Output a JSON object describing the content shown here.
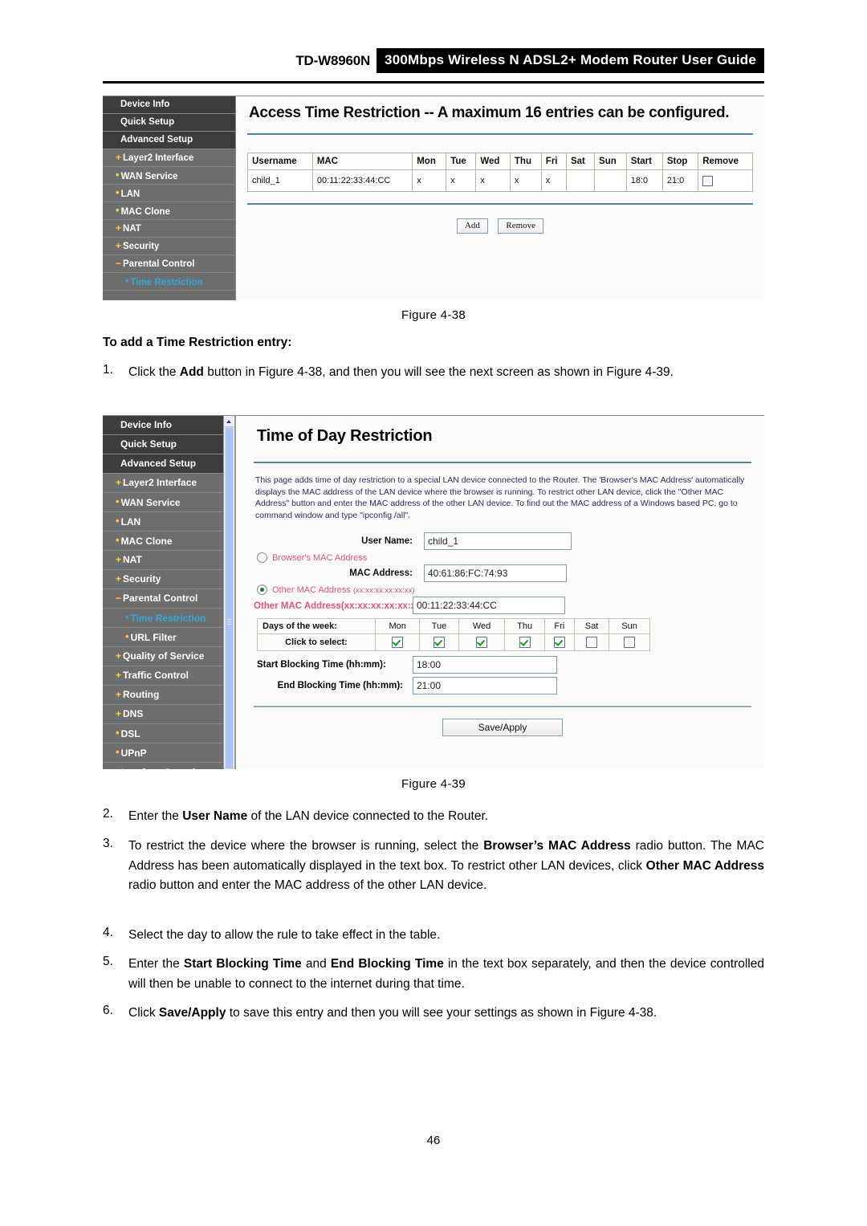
{
  "header": {
    "model": "TD-W8960N",
    "title": "300Mbps Wireless N ADSL2+ Modem Router User Guide"
  },
  "figure_4_38": {
    "panel_title": "Access Time Restriction -- A maximum 16 entries can be configured.",
    "sidebar": [
      {
        "label": "Device Info",
        "level": "top",
        "bullet": "",
        "active": false
      },
      {
        "label": "Quick Setup",
        "level": "top",
        "bullet": "",
        "active": false
      },
      {
        "label": "Advanced Setup",
        "level": "top",
        "bullet": "",
        "active": false
      },
      {
        "label": "Layer2 Interface",
        "level": "sub",
        "bullet": "+",
        "active": false
      },
      {
        "label": "WAN Service",
        "level": "sub",
        "bullet": "•",
        "active": false
      },
      {
        "label": "LAN",
        "level": "sub",
        "bullet": "•",
        "active": false
      },
      {
        "label": "MAC Clone",
        "level": "sub",
        "bullet": "•",
        "active": false
      },
      {
        "label": "NAT",
        "level": "sub",
        "bullet": "+",
        "active": false
      },
      {
        "label": "Security",
        "level": "sub",
        "bullet": "+",
        "active": false
      },
      {
        "label": "Parental Control",
        "level": "sub",
        "bullet": "−",
        "active": false
      },
      {
        "label": "Time Restriction",
        "level": "sub2",
        "bullet": "•",
        "active": true
      }
    ],
    "table": {
      "columns": [
        "Username",
        "MAC",
        "Mon",
        "Tue",
        "Wed",
        "Thu",
        "Fri",
        "Sat",
        "Sun",
        "Start",
        "Stop",
        "Remove"
      ],
      "rows": [
        {
          "username": "child_1",
          "mac": "00:11:22:33:44:CC",
          "mon": "x",
          "tue": "x",
          "wed": "x",
          "thu": "x",
          "fri": "x",
          "sat": "",
          "sun": "",
          "start": "18:0",
          "stop": "21:0",
          "remove_checked": false
        }
      ]
    },
    "buttons": {
      "add": "Add",
      "remove": "Remove"
    }
  },
  "caption_4_38": "Figure 4-38",
  "section_heading": "To add a Time Restriction entry:",
  "step1": {
    "num": "1.",
    "parts": [
      {
        "t": "Click the ",
        "b": false
      },
      {
        "t": "Add",
        "b": true
      },
      {
        "t": " button in Figure 4-38, and then you will see the next screen as shown in Figure 4-39.",
        "b": false
      }
    ]
  },
  "figure_4_39": {
    "panel_title": "Time of Day Restriction",
    "description": "This page adds time of day restriction to a special LAN device connected to the Router. The 'Browser's MAC Address' automatically displays the MAC address of the LAN device where the browser is running. To restrict other LAN device, click the \"Other MAC Address\" button and enter the MAC address of the other LAN device. To find out the MAC address of a Windows based PC, go to command window and type \"ipconfig /all\".",
    "sidebar": [
      {
        "label": "Device Info",
        "level": "top",
        "bullet": "",
        "active": false
      },
      {
        "label": "Quick Setup",
        "level": "top",
        "bullet": "",
        "active": false
      },
      {
        "label": "Advanced Setup",
        "level": "top",
        "bullet": "",
        "active": false
      },
      {
        "label": "Layer2 Interface",
        "level": "sub",
        "bullet": "+",
        "active": false
      },
      {
        "label": "WAN Service",
        "level": "sub",
        "bullet": "•",
        "active": false
      },
      {
        "label": "LAN",
        "level": "sub",
        "bullet": "•",
        "active": false
      },
      {
        "label": "MAC Clone",
        "level": "sub",
        "bullet": "•",
        "active": false
      },
      {
        "label": "NAT",
        "level": "sub",
        "bullet": "+",
        "active": false
      },
      {
        "label": "Security",
        "level": "sub",
        "bullet": "+",
        "active": false
      },
      {
        "label": "Parental Control",
        "level": "sub",
        "bullet": "−",
        "active": false
      },
      {
        "label": "Time Restriction",
        "level": "sub2",
        "bullet": "•",
        "active": true
      },
      {
        "label": "URL Filter",
        "level": "sub2",
        "bullet": "•",
        "active": false
      },
      {
        "label": "Quality of Service",
        "level": "sub",
        "bullet": "+",
        "active": false
      },
      {
        "label": "Traffic Control",
        "level": "sub",
        "bullet": "+",
        "active": false
      },
      {
        "label": "Routing",
        "level": "sub",
        "bullet": "+",
        "active": false
      },
      {
        "label": "DNS",
        "level": "sub",
        "bullet": "+",
        "active": false
      },
      {
        "label": "DSL",
        "level": "sub",
        "bullet": "•",
        "active": false
      },
      {
        "label": "UPnP",
        "level": "sub",
        "bullet": "•",
        "active": false
      },
      {
        "label": "Interface Grouping",
        "level": "sub",
        "bullet": "•",
        "active": false
      }
    ],
    "form": {
      "user_name_label": "User Name:",
      "user_name_value": "child_1",
      "browsers_mac_radio_label": "Browser's MAC Address",
      "browsers_mac_selected": false,
      "mac_address_label": "MAC Address:",
      "mac_address_value": "40:61:86:FC:74:93",
      "other_mac_radio_label": "Other MAC Address",
      "other_mac_radio_format": "(xx:xx:xx:xx:xx:xx)",
      "other_mac_selected": true,
      "other_mac_label": "Other MAC Address(xx:xx:xx:xx:xx:xx):",
      "other_mac_value": "00:11:22:33:44:CC",
      "days_label": "Days of the week:",
      "click_label": "Click to select:",
      "days": [
        {
          "name": "Mon",
          "checked": true
        },
        {
          "name": "Tue",
          "checked": true
        },
        {
          "name": "Wed",
          "checked": true
        },
        {
          "name": "Thu",
          "checked": true
        },
        {
          "name": "Fri",
          "checked": true
        },
        {
          "name": "Sat",
          "checked": false
        },
        {
          "name": "Sun",
          "checked": false
        }
      ],
      "start_label": "Start Blocking Time (hh:mm):",
      "start_value": "18:00",
      "end_label": "End Blocking Time (hh:mm):",
      "end_value": "21:00",
      "save_label": "Save/Apply"
    }
  },
  "caption_4_39": "Figure 4-39",
  "step2": {
    "num": "2.",
    "parts": [
      {
        "t": "Enter the ",
        "b": false
      },
      {
        "t": "User Name",
        "b": true
      },
      {
        "t": " of the LAN device connected to the Router.",
        "b": false
      }
    ]
  },
  "step3": {
    "num": "3.",
    "parts": [
      {
        "t": "To restrict the device where the browser is running, select the ",
        "b": false
      },
      {
        "t": "Browser’s MAC Address",
        "b": true
      },
      {
        "t": " radio button. The MAC Address has been automatically displayed in the text box. To restrict other LAN devices, click ",
        "b": false
      },
      {
        "t": "Other MAC Address",
        "b": true
      },
      {
        "t": " radio button and enter the MAC address of the other LAN device.",
        "b": false
      }
    ]
  },
  "step4": {
    "num": "4.",
    "parts": [
      {
        "t": "Select the day to allow the rule to take effect in the table.",
        "b": false
      }
    ]
  },
  "step5": {
    "num": "5.",
    "parts": [
      {
        "t": "Enter the ",
        "b": false
      },
      {
        "t": "Start Blocking Time",
        "b": true
      },
      {
        "t": " and ",
        "b": false
      },
      {
        "t": "End Blocking Time",
        "b": true
      },
      {
        "t": " in the text box separately, and then the device controlled will then be unable to connect to the internet during that time.",
        "b": false
      }
    ]
  },
  "step6": {
    "num": "6.",
    "parts": [
      {
        "t": "Click ",
        "b": false
      },
      {
        "t": "Save/Apply",
        "b": true
      },
      {
        "t": " to save this entry and then you will see your settings as shown in Figure 4-38.",
        "b": false
      }
    ]
  },
  "page_number": "46",
  "colors": {
    "accent_blue": "#4f81bd",
    "sidebar_bg": "#6e6e6e",
    "sidebar_top_bg": "#3d3d3d",
    "bullet_gold": "#ffcc33",
    "active_cyan": "#2ea9e0",
    "radio_label_red": "#e8546e",
    "desc_text": "#2b2b5e"
  }
}
